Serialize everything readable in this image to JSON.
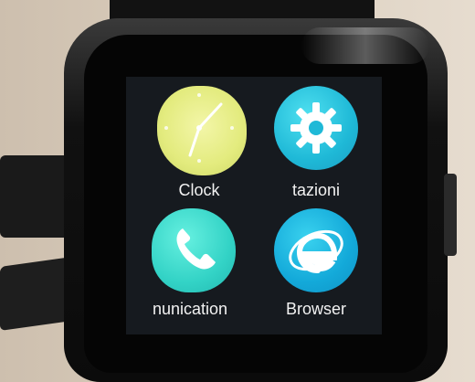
{
  "apps": [
    {
      "label": "Clock",
      "icon": "clock-icon",
      "color": "#e3eb7e"
    },
    {
      "label": "tazioni",
      "icon": "gear-icon",
      "color": "#1fb9d7"
    },
    {
      "label": "nunication",
      "icon": "phone-icon",
      "color": "#33d3c6"
    },
    {
      "label": "Browser",
      "icon": "browser-icon",
      "color": "#13a9d9"
    }
  ]
}
